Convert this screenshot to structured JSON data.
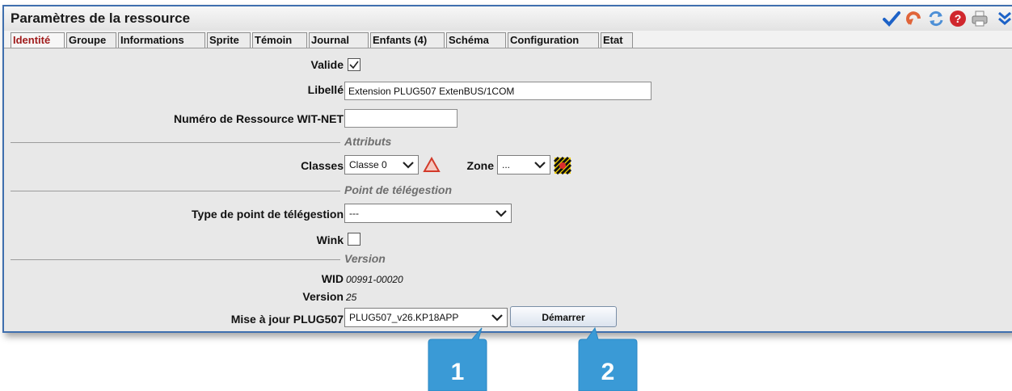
{
  "window": {
    "title": "Paramètres de la ressource"
  },
  "toolbar": {
    "icons": [
      "checkmark-icon",
      "undo-icon",
      "refresh-icon",
      "help-icon",
      "print-icon",
      "collapse-icon"
    ]
  },
  "tabs": [
    {
      "label": "Identité",
      "active": true
    },
    {
      "label": "Groupe"
    },
    {
      "label": "Informations"
    },
    {
      "label": "Sprite"
    },
    {
      "label": "Témoin"
    },
    {
      "label": "Journal"
    },
    {
      "label": "Enfants (4)"
    },
    {
      "label": "Schéma"
    },
    {
      "label": "Configuration"
    },
    {
      "label": "Etat"
    }
  ],
  "form": {
    "valide_label": "Valide",
    "valide_checked": true,
    "libelle_label": "Libellé",
    "libelle_value": "Extension PLUG507 ExtenBUS/1COM",
    "numero_label": "Numéro de Ressource WIT-NET",
    "numero_value": "",
    "section_attributs": "Attributs",
    "classes_label": "Classes",
    "classes_value": "Classe 0",
    "zone_label": "Zone",
    "zone_value": "...",
    "section_point": "Point de télégestion",
    "type_point_label": "Type de point de télégestion",
    "type_point_value": "---",
    "wink_label": "Wink",
    "wink_checked": false,
    "section_version": "Version",
    "wid_label": "WID",
    "wid_value": "00991-00020",
    "version_label": "Version",
    "version_value": "25",
    "maj_label": "Mise à jour PLUG507",
    "maj_value": "PLUG507_v26.KP18APP",
    "demarrer_label": "Démarrer"
  },
  "callouts": [
    {
      "number": "1"
    },
    {
      "number": "2"
    }
  ],
  "colors": {
    "window_border": "#3f6fae",
    "active_tab": "#a01c1c",
    "callout": "#3a9ad6"
  }
}
